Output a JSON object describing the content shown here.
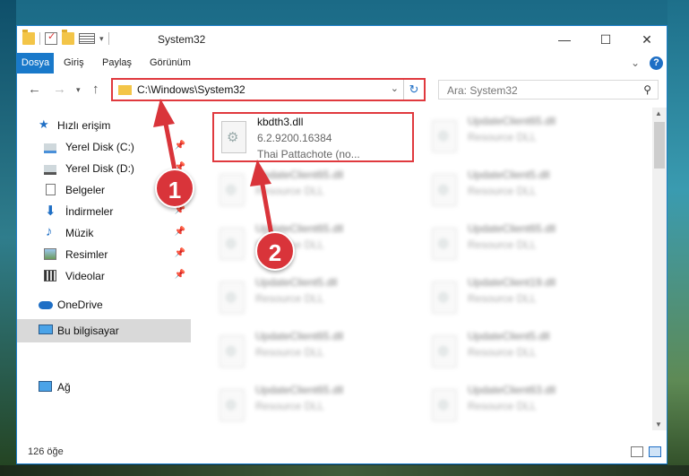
{
  "window": {
    "title": "System32",
    "controls": {
      "minimize": "—",
      "maximize": "☐",
      "close": "✕"
    }
  },
  "ribbon": {
    "tabs": [
      "Dosya",
      "Giriş",
      "Paylaş",
      "Görünüm"
    ]
  },
  "address": {
    "path": "C:\\Windows\\System32",
    "search_placeholder": "Ara: System32"
  },
  "nav_pane": {
    "items": [
      {
        "label": "Hızlı erişim",
        "icon": "star-icon",
        "pinned": false
      },
      {
        "label": "Yerel Disk (C:)",
        "icon": "drive-icon",
        "pinned": true
      },
      {
        "label": "Yerel Disk (D:)",
        "icon": "drive-icon",
        "pinned": true
      },
      {
        "label": "Belgeler",
        "icon": "document-icon",
        "pinned": true
      },
      {
        "label": "İndirmeler",
        "icon": "download-icon",
        "pinned": true
      },
      {
        "label": "Müzik",
        "icon": "music-icon",
        "pinned": true
      },
      {
        "label": "Resimler",
        "icon": "pictures-icon",
        "pinned": true
      },
      {
        "label": "Videolar",
        "icon": "video-icon",
        "pinned": true
      },
      {
        "label": "OneDrive",
        "icon": "cloud-icon",
        "pinned": false
      },
      {
        "label": "Bu bilgisayar",
        "icon": "computer-icon",
        "pinned": false,
        "selected": true
      },
      {
        "label": "Ağ",
        "icon": "network-icon",
        "pinned": false
      }
    ]
  },
  "files": [
    {
      "name": "kbdth3.dll",
      "line2": "6.2.9200.16384",
      "line3": "Thai Pattachote (no...",
      "highlight": true
    },
    {
      "name": "UpdateClient65.dll",
      "line2": "Resource DLL"
    },
    {
      "name": "UpdateClient65.dll",
      "line2": "Resource DLL"
    },
    {
      "name": "UpdateClient5.dll",
      "line2": "Resource DLL"
    },
    {
      "name": "UpdateClient65.dll",
      "line2": "Resource DLL"
    },
    {
      "name": "UpdateClient65.dll",
      "line2": "Resource DLL"
    },
    {
      "name": "UpdateClient5.dll",
      "line2": "Resource DLL"
    },
    {
      "name": "UpdateClient19.dll",
      "line2": "Resource DLL"
    },
    {
      "name": "UpdateClient65.dll",
      "line2": "Resource DLL"
    },
    {
      "name": "UpdateClient5.dll",
      "line2": "Resource DLL"
    },
    {
      "name": "UpdateClient65.dll",
      "line2": "Resource DLL"
    },
    {
      "name": "UpdateClient63.dll",
      "line2": "Resource DLL"
    }
  ],
  "status": {
    "item_count": "126 öğe"
  },
  "annotations": {
    "step1": "1",
    "step2": "2",
    "color": "#d9343a"
  }
}
